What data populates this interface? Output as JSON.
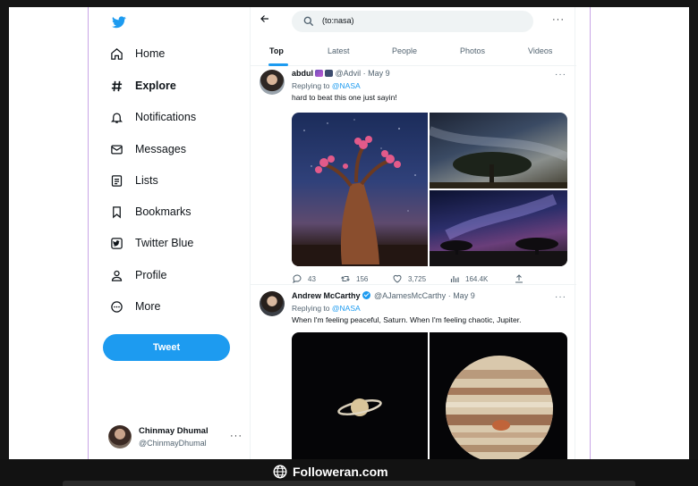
{
  "sidebar": {
    "items": [
      {
        "label": "Home",
        "icon": "home-icon"
      },
      {
        "label": "Explore",
        "icon": "hashtag-icon",
        "active": true
      },
      {
        "label": "Notifications",
        "icon": "bell-icon"
      },
      {
        "label": "Messages",
        "icon": "envelope-icon"
      },
      {
        "label": "Lists",
        "icon": "list-icon"
      },
      {
        "label": "Bookmarks",
        "icon": "bookmark-icon"
      },
      {
        "label": "Twitter Blue",
        "icon": "twitter-blue-icon"
      },
      {
        "label": "Profile",
        "icon": "person-icon"
      },
      {
        "label": "More",
        "icon": "more-circle-icon"
      }
    ],
    "tweet_button": "Tweet",
    "account": {
      "name": "Chinmay Dhumal",
      "handle": "@ChinmayDhumal",
      "more": "···"
    }
  },
  "search": {
    "query": "(to:nasa)",
    "more": "···"
  },
  "tabs": [
    "Top",
    "Latest",
    "People",
    "Photos",
    "Videos"
  ],
  "tweets": [
    {
      "name": "abdul",
      "handle": "@Advil",
      "date": "May 9",
      "replying_prefix": "Replying to",
      "replying_to": "@NASA",
      "text": "hard to beat this one just sayin!",
      "stats": {
        "replies": "43",
        "retweets": "156",
        "likes": "3,725",
        "views": "164.4K"
      }
    },
    {
      "name": "Andrew McCarthy",
      "handle": "@AJamesMcCarthy",
      "date": "May 9",
      "replying_prefix": "Replying to",
      "replying_to": "@NASA",
      "text": "When I'm feeling peaceful, Saturn. When I'm feeling chaotic, Jupiter."
    }
  ],
  "footer": {
    "brand": "Followeran.com"
  },
  "colors": {
    "accent": "#1d9bf0",
    "frame": "#c9a6e6"
  }
}
